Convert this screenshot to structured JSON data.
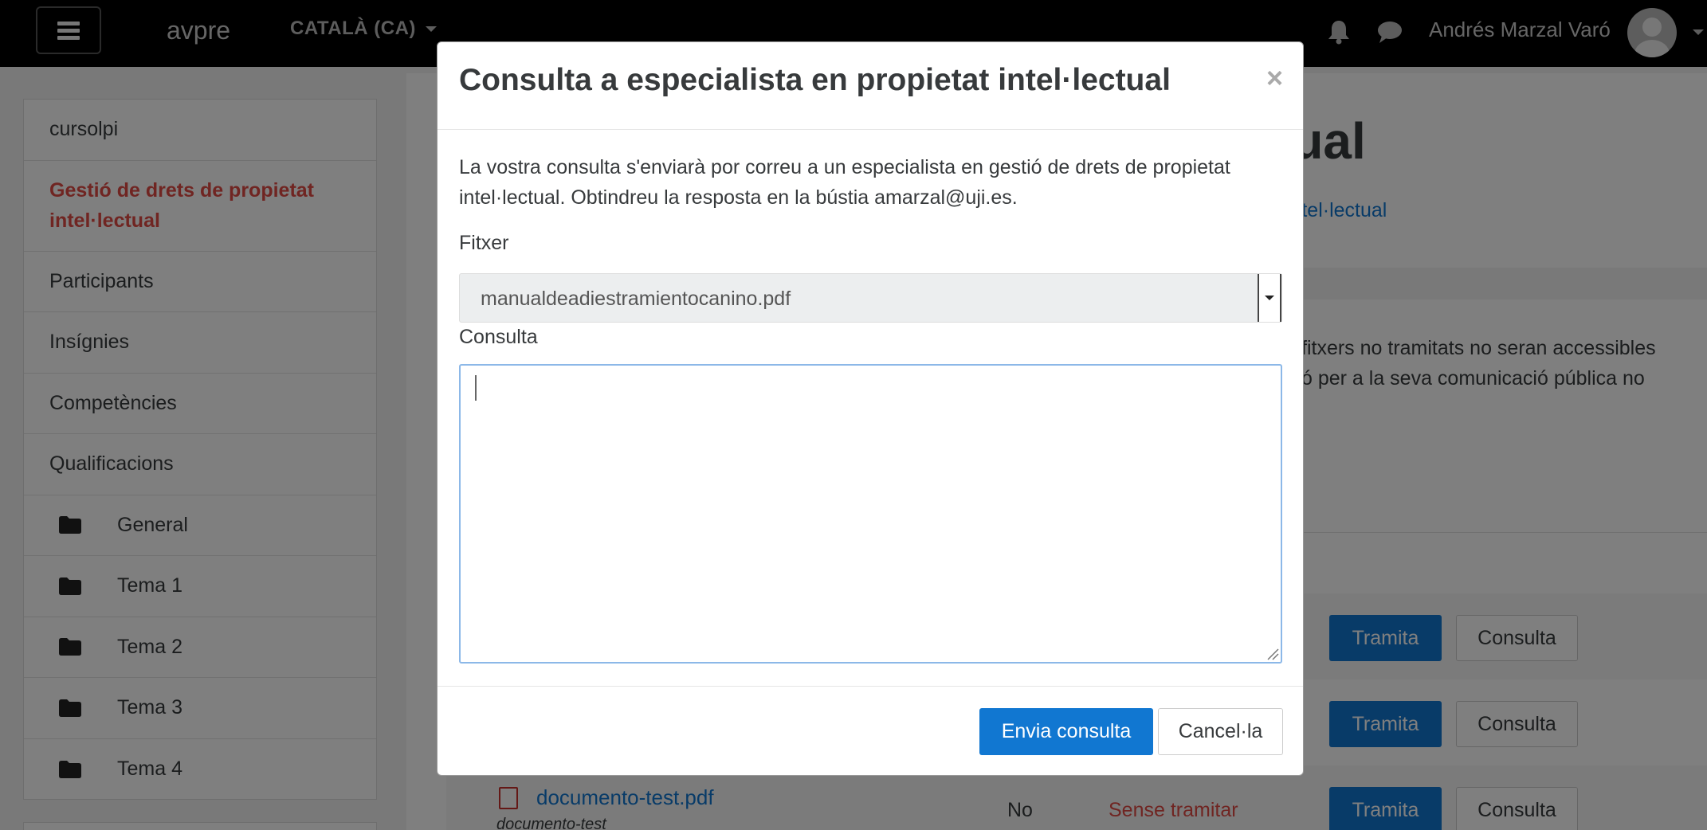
{
  "navbar": {
    "brand": "avpre",
    "language": "CATALÀ (CA)",
    "user_name": "Andrés Marzal Varó",
    "icons": [
      "hamburger-menu-icon",
      "bell-icon",
      "chat-icon",
      "user-avatar-icon"
    ]
  },
  "sidebar": {
    "items": [
      {
        "label": "cursolpi"
      },
      {
        "label": "Gestió de drets de propietat intel·lectual",
        "active": true
      },
      {
        "label": "Participants"
      },
      {
        "label": "Insígnies"
      },
      {
        "label": "Competències"
      },
      {
        "label": "Qualificacions"
      }
    ],
    "sections": [
      {
        "label": "General",
        "icon": "folder-icon"
      },
      {
        "label": "Tema 1",
        "icon": "folder-icon"
      },
      {
        "label": "Tema 2",
        "icon": "folder-icon"
      },
      {
        "label": "Tema 3",
        "icon": "folder-icon"
      },
      {
        "label": "Tema 4",
        "icon": "folder-icon"
      }
    ]
  },
  "background_page": {
    "title_fragment": "tual",
    "link_fragment": "t intel·lectual",
    "text_line1": "fitxers no tramitats no seran accessibles",
    "text_line2": "ó per a la seva comunicació pública no",
    "rows": [
      {
        "tramita": "Tramita",
        "consulta": "Consulta"
      },
      {
        "tramita": "Tramita",
        "consulta": "Consulta"
      },
      {
        "tramita": "Tramita",
        "consulta": "Consulta",
        "file": "documento-test.pdf",
        "file_sub": "documento-test",
        "processed": "No",
        "status": "Sense tramitar"
      }
    ]
  },
  "modal": {
    "title": "Consulta a especialista en propietat intel·lectual",
    "close": "×",
    "description": "La vostra consulta s'enviarà por correu a un especialista en gestió de drets de propietat intel·lectual. Obtindreu la resposta en la bústia amarzal@uji.es.",
    "file_label": "Fitxer",
    "file_selected": "manualdeadiestramientocanino.pdf",
    "query_label": "Consulta",
    "query_value": "",
    "send_button": "Envia consulta",
    "cancel_button": "Cancel·la"
  },
  "colors": {
    "primary": "#1177d1",
    "active_link": "#e04b44",
    "navbar": "#000000"
  }
}
